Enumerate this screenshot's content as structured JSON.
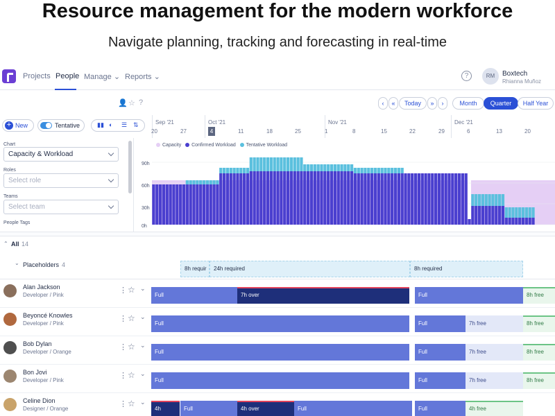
{
  "hero": {
    "title": "Resource management for the modern workforce",
    "subtitle": "Navigate planning, tracking and forecasting in real-time"
  },
  "nav": {
    "items": [
      "Projects",
      "People",
      "Manage",
      "Reports"
    ],
    "active": "People",
    "help": "?",
    "avatar_initials": "RM",
    "org": "Boxtech",
    "user": "Rhianna Muñoz"
  },
  "toolbar": {
    "today": "Today",
    "views": [
      "Month",
      "Quarter",
      "Half Year"
    ],
    "selected_view": "Quarter",
    "new_label": "New",
    "tentative_label": "Tentative"
  },
  "timeline": {
    "months": [
      "Sep '21",
      "Oct '21",
      "Nov '21",
      "Dec '21"
    ],
    "days": [
      "20",
      "27",
      "4",
      "11",
      "18",
      "25",
      "1",
      "8",
      "15",
      "22",
      "29",
      "6",
      "13",
      "20"
    ],
    "current_day": "4"
  },
  "filters": {
    "chart_label": "Chart",
    "chart_value": "Capacity & Workload",
    "roles_label": "Roles",
    "roles_placeholder": "Select role",
    "teams_label": "Teams",
    "teams_placeholder": "Select team",
    "tags_label": "People Tags"
  },
  "chart_data": {
    "type": "bar",
    "legend": [
      "Capacity",
      "Confirmed Workload",
      "Tentative Workload"
    ],
    "colors": {
      "capacity": "#e5cff5",
      "confirmed": "#4a3fcf",
      "tentative": "#5bc0de"
    },
    "ylabels": [
      "90h",
      "60h",
      "30h",
      "0h"
    ],
    "ylim": [
      0,
      100
    ],
    "series": [
      {
        "name": "Capacity",
        "values": [
          64,
          64,
          64,
          64,
          64,
          64,
          64,
          64,
          64,
          64,
          64,
          64,
          64,
          64,
          64,
          64,
          64,
          64,
          64,
          64,
          64,
          64,
          64,
          64,
          64,
          64,
          64,
          64,
          64,
          64,
          64,
          64,
          64,
          64,
          64,
          64,
          64,
          64,
          64,
          64,
          64,
          64,
          64,
          64,
          64,
          64,
          64,
          64,
          64,
          64,
          64,
          64,
          64,
          64,
          64,
          64,
          64,
          64,
          64,
          64,
          64,
          64,
          64,
          64,
          64,
          64,
          64,
          64,
          64,
          64,
          64,
          64,
          64,
          64,
          64,
          64,
          64,
          64,
          64,
          64,
          64,
          64,
          64,
          64,
          64,
          64,
          64,
          64,
          64,
          64,
          64,
          64,
          64,
          64,
          64,
          64,
          64,
          64,
          64,
          64,
          64,
          64,
          64,
          64,
          64,
          64,
          64,
          64,
          64,
          64,
          64,
          64,
          64,
          64,
          64,
          64,
          64,
          64,
          64,
          64
        ]
      },
      {
        "name": "Confirmed Workload",
        "values": [
          58,
          58,
          58,
          58,
          58,
          58,
          58,
          58,
          58,
          58,
          58,
          58,
          58,
          58,
          58,
          58,
          58,
          58,
          58,
          58,
          58,
          58,
          58,
          58,
          58,
          58,
          58,
          58,
          58,
          58,
          58,
          58,
          58,
          58,
          58,
          58,
          58,
          58,
          58,
          58,
          58,
          58,
          58,
          58,
          58,
          58,
          58,
          58,
          58,
          58,
          58,
          58,
          58,
          58,
          58,
          58,
          58,
          58,
          58,
          58,
          58,
          58,
          58,
          58,
          58,
          58,
          58,
          58,
          58,
          58,
          58,
          58,
          58,
          58,
          58,
          58,
          58,
          58,
          58,
          58,
          58,
          58,
          58,
          58,
          58,
          58,
          58,
          58,
          58,
          58,
          58,
          58,
          58,
          58,
          58,
          58,
          58,
          58,
          58,
          58,
          58,
          58,
          58,
          58,
          58,
          58,
          58,
          58,
          58,
          58,
          58,
          58,
          58,
          58,
          58,
          58,
          58,
          58,
          58,
          58
        ]
      },
      {
        "name": "Tentative Workload",
        "values": [
          0,
          0,
          0,
          0,
          0,
          0,
          0,
          0,
          0,
          0,
          0,
          0,
          0,
          0,
          0,
          0,
          0,
          0,
          0,
          0,
          0,
          0,
          0,
          0,
          0,
          0,
          0,
          0,
          0,
          0,
          0,
          0,
          0,
          0,
          0,
          0,
          0,
          0,
          0,
          0,
          0,
          0,
          0,
          0,
          0,
          0,
          0,
          0,
          0,
          0,
          0,
          0,
          0,
          0,
          0,
          0,
          0,
          0,
          0,
          0,
          0,
          0,
          0,
          0,
          0,
          0,
          0,
          0,
          0,
          0,
          0,
          0,
          0,
          0,
          0,
          0,
          0,
          0,
          0,
          0,
          0,
          0,
          0,
          0,
          0,
          0,
          0,
          0,
          0,
          0,
          0,
          0,
          0,
          0,
          0,
          0,
          0,
          0,
          0,
          0,
          0,
          0,
          0,
          0,
          0,
          0,
          0,
          0,
          0,
          0,
          0,
          0,
          0,
          0,
          0,
          0,
          0,
          0,
          0,
          0
        ]
      }
    ],
    "groups": [
      {
        "from": 0,
        "to": 9,
        "confirmed": 58,
        "tentative": 0,
        "capacity": 64
      },
      {
        "from": 10,
        "to": 19,
        "confirmed": 58,
        "tentative": 6,
        "capacity": 64
      },
      {
        "from": 20,
        "to": 28,
        "confirmed": 74,
        "tentative": 8,
        "capacity": 64
      },
      {
        "from": 29,
        "to": 44,
        "confirmed": 77,
        "tentative": 20,
        "capacity": 64
      },
      {
        "from": 45,
        "to": 59,
        "confirmed": 77,
        "tentative": 10,
        "capacity": 64
      },
      {
        "from": 60,
        "to": 74,
        "confirmed": 74,
        "tentative": 8,
        "capacity": 64
      },
      {
        "from": 75,
        "to": 93,
        "confirmed": 74,
        "tentative": 0,
        "capacity": 64
      },
      {
        "from": 94,
        "to": 94,
        "confirmed": 8,
        "tentative": 0,
        "capacity": 64
      },
      {
        "from": 95,
        "to": 104,
        "confirmed": 27,
        "tentative": 17,
        "capacity": 64
      },
      {
        "from": 105,
        "to": 113,
        "confirmed": 10,
        "tentative": 15,
        "capacity": 64
      },
      {
        "from": 114,
        "to": 119,
        "confirmed": 0,
        "tentative": 0,
        "capacity": 64
      }
    ],
    "capacity_levels": [
      {
        "from": 0,
        "to": 93,
        "value": 64
      },
      {
        "from": 94,
        "to": 94,
        "value": 8
      },
      {
        "from": 95,
        "to": 119,
        "value": 64
      }
    ]
  },
  "people_section": {
    "all_label": "All",
    "all_count": "14",
    "placeholders_label": "Placeholders",
    "placeholders_count": "4",
    "placeholder_bars": [
      "8h requir",
      "24h required",
      "8h required"
    ]
  },
  "people": [
    {
      "name": "Alan Jackson",
      "role": "Developer / Pink",
      "avatar_color": "#8a6f5c",
      "segments": [
        {
          "label": "Full",
          "kind": "full"
        },
        {
          "label": "7h over",
          "kind": "over"
        },
        {
          "label": "Full",
          "kind": "full"
        },
        {
          "label": "8h free",
          "kind": "freeg"
        }
      ]
    },
    {
      "name": "Beyoncé Knowles",
      "role": "Developer / Pink",
      "avatar_color": "#b0683e",
      "segments": [
        {
          "label": "Full",
          "kind": "full"
        },
        {
          "label": "Full",
          "kind": "full"
        },
        {
          "label": "7h free",
          "kind": "free"
        },
        {
          "label": "8h free",
          "kind": "freeg"
        }
      ]
    },
    {
      "name": "Bob Dylan",
      "role": "Developer / Orange",
      "avatar_color": "#4f4f4f",
      "segments": [
        {
          "label": "Full",
          "kind": "full"
        },
        {
          "label": "Full",
          "kind": "full"
        },
        {
          "label": "7h free",
          "kind": "free"
        },
        {
          "label": "8h free",
          "kind": "freeg"
        }
      ]
    },
    {
      "name": "Bon Jovi",
      "role": "Developer / Pink",
      "avatar_color": "#9c8670",
      "segments": [
        {
          "label": "Full",
          "kind": "full"
        },
        {
          "label": "Full",
          "kind": "full"
        },
        {
          "label": "7h free",
          "kind": "free"
        },
        {
          "label": "8h free",
          "kind": "freeg"
        }
      ]
    },
    {
      "name": "Celine Dion",
      "role": "Designer / Orange",
      "avatar_color": "#c9a36a",
      "segments": [
        {
          "label": "4h",
          "kind": "over"
        },
        {
          "label": "Full",
          "kind": "full"
        },
        {
          "label": "4h over",
          "kind": "over"
        },
        {
          "label": "Full",
          "kind": "full"
        },
        {
          "label": "Full",
          "kind": "full"
        },
        {
          "label": "4h free",
          "kind": "freeg"
        }
      ]
    }
  ]
}
